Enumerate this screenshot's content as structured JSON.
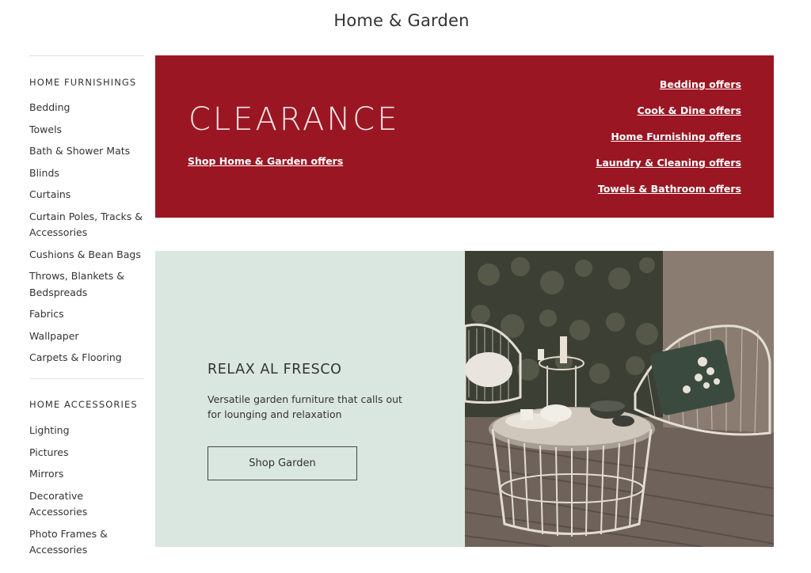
{
  "page": {
    "title": "Home & Garden"
  },
  "sidebar": {
    "sections": [
      {
        "title": "HOME FURNISHINGS",
        "items": [
          {
            "label": "Bedding"
          },
          {
            "label": "Towels"
          },
          {
            "label": "Bath & Shower Mats"
          },
          {
            "label": "Blinds"
          },
          {
            "label": "Curtains"
          },
          {
            "label": "Curtain Poles, Tracks & Accessories"
          },
          {
            "label": "Cushions & Bean Bags"
          },
          {
            "label": "Throws, Blankets & Bedspreads"
          },
          {
            "label": "Fabrics"
          },
          {
            "label": "Wallpaper"
          },
          {
            "label": "Carpets & Flooring"
          }
        ]
      },
      {
        "title": "HOME ACCESSORIES",
        "items": [
          {
            "label": "Lighting"
          },
          {
            "label": "Pictures"
          },
          {
            "label": "Mirrors"
          },
          {
            "label": "Decorative Accessories"
          },
          {
            "label": "Photo Frames & Accessories"
          }
        ]
      }
    ]
  },
  "clearance": {
    "title": "CLEARANCE",
    "shop_link": "Shop Home & Garden offers",
    "offers": [
      {
        "label": "Bedding offers"
      },
      {
        "label": "Cook & Dine offers"
      },
      {
        "label": "Home Furnishing offers"
      },
      {
        "label": "Laundry & Cleaning offers"
      },
      {
        "label": "Towels & Bathroom offers"
      }
    ],
    "background_color": "#9b1623"
  },
  "promo": {
    "heading": "RELAX AL FRESCO",
    "description": "Versatile garden furniture that calls out for lounging and relaxation",
    "button_label": "Shop Garden",
    "background_color": "#dae7e0",
    "image_icon": "garden-furniture-photo"
  }
}
